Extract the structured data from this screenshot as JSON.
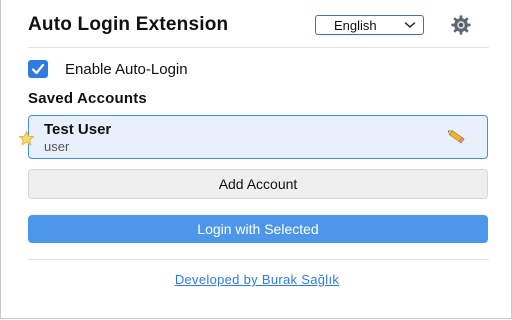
{
  "header": {
    "title": "Auto Login Extension",
    "language_selected": "English",
    "settings_icon": "gear-icon"
  },
  "settings": {
    "enable_auto_login_label": "Enable Auto-Login",
    "enable_auto_login_checked": true
  },
  "accounts": {
    "section_title": "Saved Accounts",
    "items": [
      {
        "name": "Test User",
        "username": "user",
        "is_default": true,
        "default_icon": "star-icon",
        "edit_icon": "pencil-icon"
      }
    ]
  },
  "actions": {
    "add_account_label": "Add Account",
    "login_selected_label": "Login with Selected"
  },
  "footer": {
    "credit_link": "Developed by Burak Sağlık"
  },
  "colors": {
    "accent": "#2f7be0",
    "primary_button": "#4c97ea",
    "selected_card_bg": "#e8f1fb",
    "selected_card_border": "#4a90d9"
  }
}
